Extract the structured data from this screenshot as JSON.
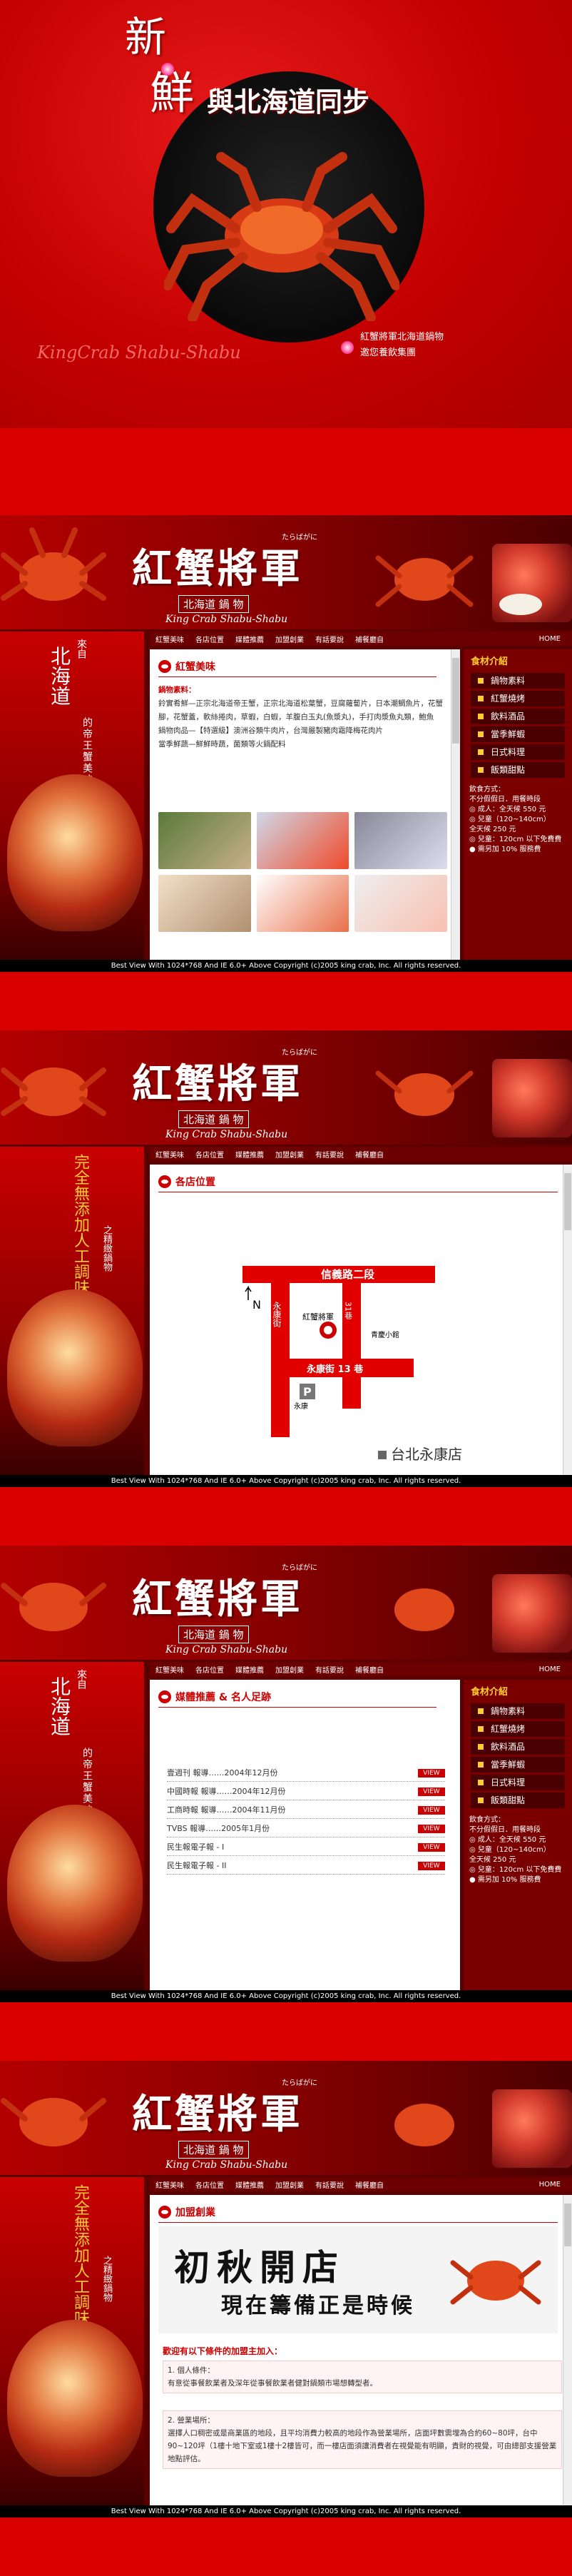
{
  "hero": {
    "title_char1": "新",
    "title_char2": "鮮",
    "tagline": "與北海道同步",
    "brand_italic": "KingCrab Shabu-Shabu",
    "note_line1": "紅蟹將軍北海道鍋物",
    "note_line2": "邀您養飲集團"
  },
  "banner": {
    "logo": "紅蟹將軍",
    "kana": "たらばがに",
    "sub_cn": "北海道 鍋 物",
    "sub_en": "King Crab Shabu-Shabu"
  },
  "menu": [
    "紅蟹美味",
    "各店位置",
    "媒體推薦",
    "加盟創業",
    "有話要說",
    "補餐廳自"
  ],
  "menu_home": "HOME",
  "left": {
    "small_top": "來自",
    "big": "北海道",
    "side_a": "的帝王蟹美味",
    "alt_big": "完全無添加人工調味",
    "alt_small": "之精緻鍋物"
  },
  "right": {
    "title": "食材介紹",
    "items": [
      "鍋物素料",
      "紅蟹燒烤",
      "飲料酒品",
      "當季鮮蝦",
      "日式料理",
      "飯類甜點"
    ],
    "note_title": "飲食方式：",
    "note_lines": [
      "不分假假日．用餐時段",
      "◎ 成人：全天候 550 元",
      "◎ 兒童（120~140cm）",
      "全天候 250 元",
      "◎ 兒童：120cm 以下免費費",
      "● 需另加 10% 服務費"
    ]
  },
  "footer": "Best View With 1024*768 And IE 6.0+ Above Copyright (c)2005 king crab, Inc. All rights reserved.",
  "page1": {
    "section_title": "紅蟹美味",
    "label": "鍋物素料：",
    "text1": "鈴實肴鮮—正宗北海道帝王蟹，正宗北海道松葉蟹，豆腐蘿蔔片，日本潮鯛魚片，花蟹腳，花蟹蓋，軟絲捲肉，草蝦，白蝦，羊腹白玉丸(魚漿丸)，手打肉漿魚丸類，鮑魚",
    "text2": "鍋物肉品—【特選級】澳洲谷類牛肉片，台灣嚴製豬肉霜降梅花肉片",
    "text3": "當季鮮蔬—鮮鮮時蔬，菌類等火鍋配料"
  },
  "page2": {
    "section_title": "各店位置",
    "road_top": "信義路二段",
    "road_left": "永康街",
    "road_bottom": "永康街 13 巷",
    "road_right_small": "青慶小館",
    "lane": "31巷",
    "shop": "紅蟹將軍",
    "park_label": "P",
    "store": "台北永康店",
    "compass": "N",
    "lane_left": "永康"
  },
  "page3": {
    "section_title": "媒體推薦 & 名人足跡",
    "rows": [
      {
        "name": "壹週刊 報導",
        "date": "2004年12月份",
        "btn": "VIEW"
      },
      {
        "name": "中國時報 報導",
        "date": "2004年12月份",
        "btn": "VIEW"
      },
      {
        "name": "工商時報 報導",
        "date": "2004年11月份",
        "btn": "VIEW"
      },
      {
        "name": "TVBS 報導",
        "date": "2005年1月份",
        "btn": "VIEW"
      },
      {
        "name": "民生報電子報 - I",
        "date": "",
        "btn": "VIEW"
      },
      {
        "name": "民生報電子報 - II",
        "date": "",
        "btn": "VIEW"
      }
    ]
  },
  "page4": {
    "section_title": "加盟創業",
    "big": "初秋開店",
    "sub": "現在籌備正是時候",
    "red_heading": "歡迎有以下條件的加盟主加入：",
    "item1_title": "1. 個人條件：",
    "item1_text": "有意從事餐飲業者及深年從事餐飲業者健對鍋類市場想轉型者。",
    "item2_title": "2. 營業場所：",
    "item2_text": "選擇人口稠密或是商業區的地段，且平均消費力較高的地段作為營業場所，店面坪數需埋為合約60~80坪，台中90~120坪（1樓十地下室或1樓十2樓皆可，而一樓店面須讓消費者在視覺能有明顯，貴財的視覺，可由總部支援營業地點評估。"
  }
}
